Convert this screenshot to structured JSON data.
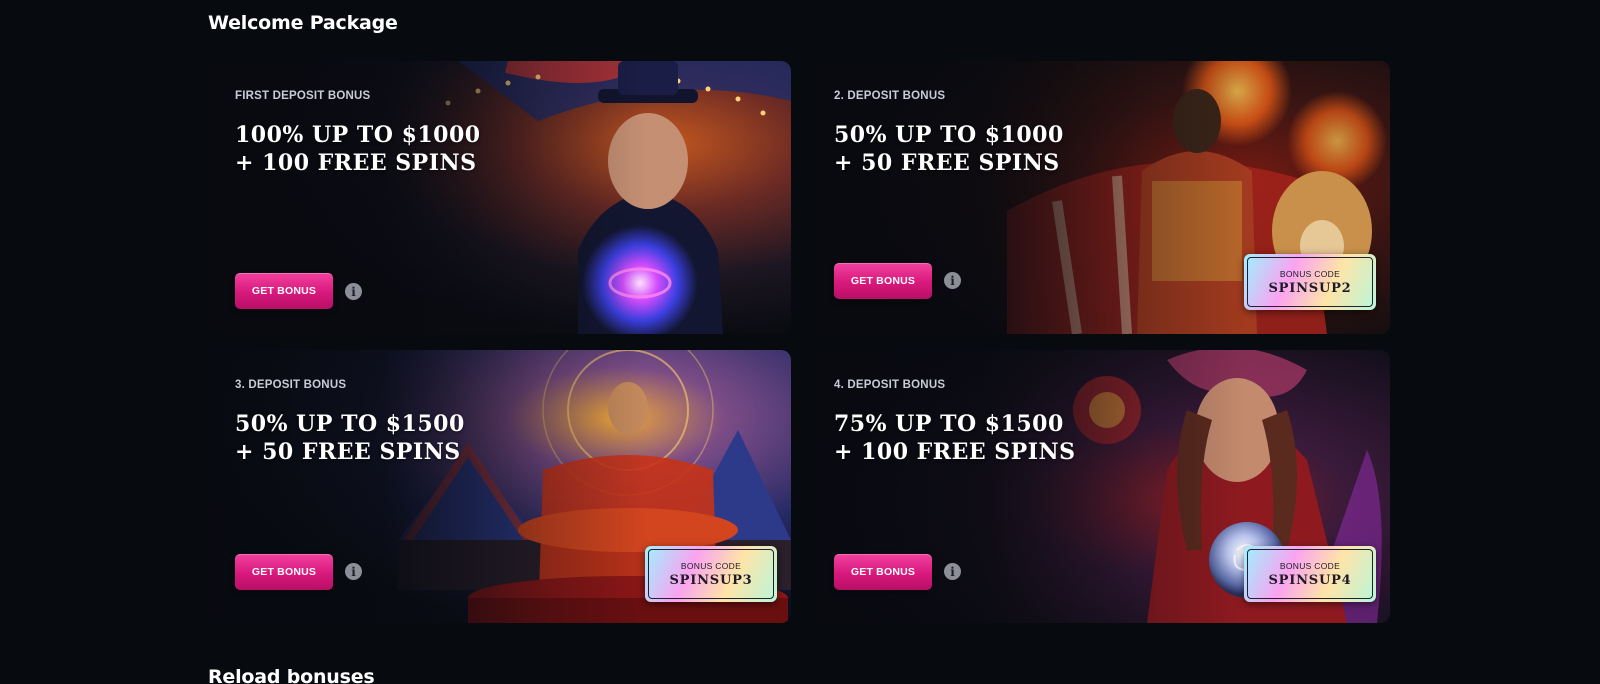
{
  "welcome_package": {
    "title": "Welcome Package",
    "cards": [
      {
        "eyebrow": "FIRST DEPOSIT BONUS",
        "headline_line1": "100% UP TO $1000",
        "headline_line2": "+ 100 FREE SPINS",
        "button_label": "GET BONUS",
        "info_symbol": "i",
        "art": "magician-crystal-orb-circus"
      },
      {
        "eyebrow": "2. DEPOSIT BONUS",
        "headline_line1": "50% UP TO $1000",
        "headline_line2": "+ 50 FREE SPINS",
        "button_label": "GET BONUS",
        "info_symbol": "i",
        "bonus_code_label": "BONUS CODE",
        "bonus_code": "SPINSUP2",
        "art": "ringmaster-with-fire-lion"
      },
      {
        "eyebrow": "3. DEPOSIT BONUS",
        "headline_line1": "50% UP TO $1500",
        "headline_line2": "+ 50 FREE SPINS",
        "button_label": "GET BONUS",
        "info_symbol": "i",
        "bonus_code_label": "BONUS CODE",
        "bonus_code": "SPINSUP3",
        "art": "levitating-monk-circus-tents"
      },
      {
        "eyebrow": "4. DEPOSIT BONUS",
        "headline_line1": "75% UP TO $1500",
        "headline_line2": "+ 100 FREE SPINS",
        "button_label": "GET BONUS",
        "info_symbol": "i",
        "bonus_code_label": "BONUS CODE",
        "bonus_code": "SPINSUP4",
        "art": "fortune-teller-crystal-ball"
      }
    ]
  },
  "reload_bonuses": {
    "title": "Reload bonuses"
  },
  "colors": {
    "background": "#070b10",
    "button_pink": "#d8187c",
    "info_gray": "#8c8f98"
  }
}
